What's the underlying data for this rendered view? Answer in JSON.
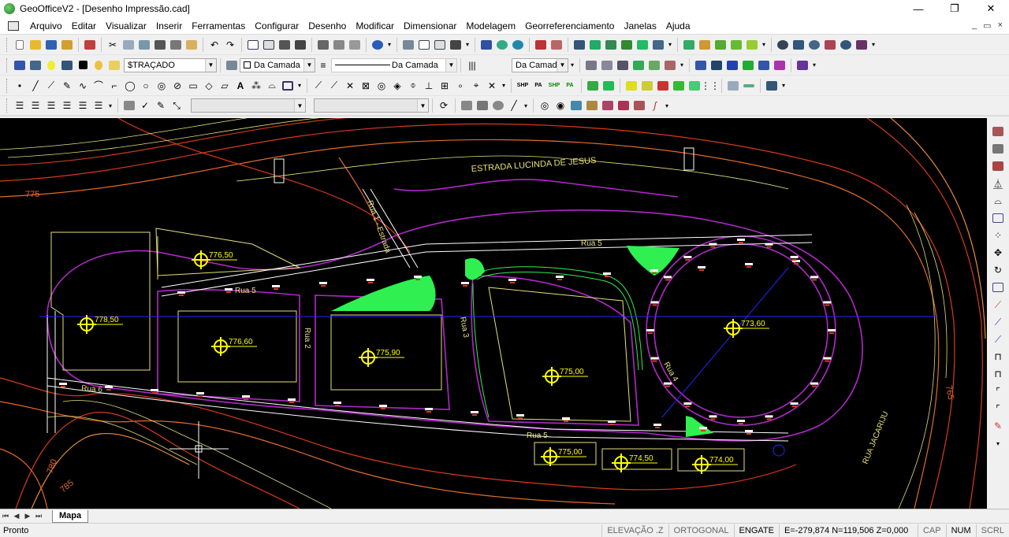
{
  "window": {
    "title": "GeoOfficeV2 - [Desenho Impressão.cad]",
    "minimize": "—",
    "maximize": "❐",
    "close": "✕"
  },
  "menu": {
    "items": [
      "Arquivo",
      "Editar",
      "Visualizar",
      "Inserir",
      "Ferramentas",
      "Configurar",
      "Desenho",
      "Modificar",
      "Dimensionar",
      "Modelagem",
      "Georreferenciamento",
      "Janelas",
      "Ajuda"
    ],
    "mdi_minimize": "_",
    "mdi_restore": "▭",
    "mdi_close": "×"
  },
  "properties": {
    "color_combo": "$TRAÇADO",
    "linetype_combo": "Da Camada",
    "line_preview_label": "Da Camada",
    "lineweight_combo": "Da Camada"
  },
  "drawing": {
    "road_label": "ESTRADA LUCINDA DE JESUS",
    "street_rua5": "Rua 5",
    "street_rua6": "Rua 6",
    "street_rua2": "Rua 2",
    "street_rua3": "Rua 3",
    "street_rua4": "Rua 4",
    "street_rua1": "Rua 1 - Estrada",
    "street_jacaraiu": "RUA JACARIJU",
    "elevations": [
      "776,50",
      "778,50",
      "776,60",
      "775,90",
      "775,00",
      "773,60",
      "775,00",
      "774,50",
      "774,00"
    ],
    "contours": [
      "775",
      "765",
      "780",
      "785"
    ]
  },
  "tabs": {
    "nav": [
      "⏮",
      "◀",
      "▶",
      "⏭"
    ],
    "active": "Mapa"
  },
  "status": {
    "left": "Pronto",
    "elevacao": "ELEVAÇÃO .Z",
    "ortogonal": "ORTOGONAL",
    "engate": "ENGATE",
    "coords": "E=-279,874 N=119,506 Z=0,000",
    "cap": "CAP",
    "num": "NUM",
    "scrl": "SCRL"
  },
  "colors": {
    "canvas_bg": "#000000",
    "contour_red": "#d83a1a",
    "contour_orange": "#e88a3a",
    "contour_yellow": "#e6e07a",
    "lot_purple": "#b028c8",
    "highlight_green": "#2ff050",
    "marker_yellow": "#ffff00",
    "axis_blue": "#2424ff"
  }
}
